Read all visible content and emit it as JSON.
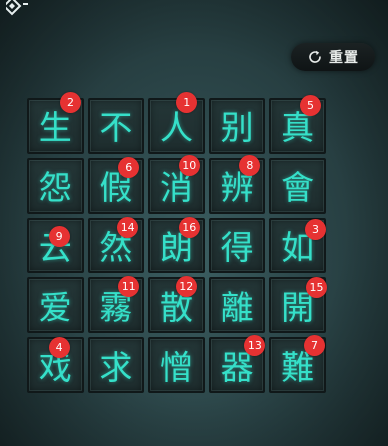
{
  "header": {
    "reset_label": "重置",
    "reset_icon": "refresh-icon",
    "back_icon": "diamond-back-icon"
  },
  "colors": {
    "glyph": "#35e0c9",
    "badge": "#e63232",
    "tile_bg": "#243637"
  },
  "grid": {
    "rows": [
      [
        {
          "char": "生",
          "badge": "2"
        },
        {
          "char": "不",
          "badge": ""
        },
        {
          "char": "人",
          "badge": "1"
        },
        {
          "char": "别",
          "badge": ""
        },
        {
          "char": "真",
          "badge": "5"
        }
      ],
      [
        {
          "char": "怨",
          "badge": ""
        },
        {
          "char": "假",
          "badge": "6"
        },
        {
          "char": "消",
          "badge": "10"
        },
        {
          "char": "辨",
          "badge": "8"
        },
        {
          "char": "會",
          "badge": ""
        }
      ],
      [
        {
          "char": "云",
          "badge": "9"
        },
        {
          "char": "然",
          "badge": "14"
        },
        {
          "char": "朗",
          "badge": "16"
        },
        {
          "char": "得",
          "badge": ""
        },
        {
          "char": "如",
          "badge": "3"
        }
      ],
      [
        {
          "char": "爱",
          "badge": ""
        },
        {
          "char": "霧",
          "badge": "11"
        },
        {
          "char": "散",
          "badge": "12"
        },
        {
          "char": "離",
          "badge": ""
        },
        {
          "char": "開",
          "badge": "15"
        }
      ],
      [
        {
          "char": "戏",
          "badge": "4"
        },
        {
          "char": "求",
          "badge": ""
        },
        {
          "char": "憎",
          "badge": ""
        },
        {
          "char": "器",
          "badge": "13"
        },
        {
          "char": "難",
          "badge": "7"
        }
      ]
    ]
  }
}
